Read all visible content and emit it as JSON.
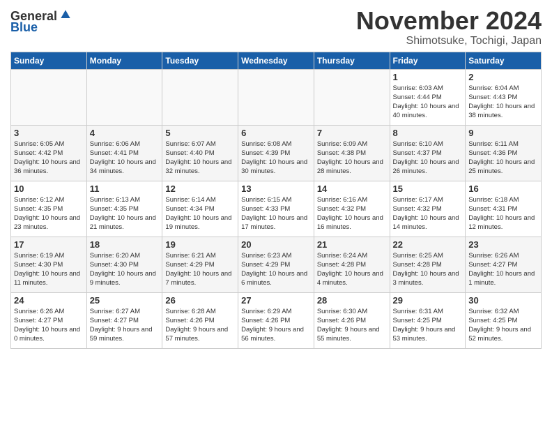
{
  "logo": {
    "general": "General",
    "blue": "Blue"
  },
  "title": "November 2024",
  "location": "Shimotsuke, Tochigi, Japan",
  "headers": [
    "Sunday",
    "Monday",
    "Tuesday",
    "Wednesday",
    "Thursday",
    "Friday",
    "Saturday"
  ],
  "weeks": [
    [
      {
        "day": "",
        "info": ""
      },
      {
        "day": "",
        "info": ""
      },
      {
        "day": "",
        "info": ""
      },
      {
        "day": "",
        "info": ""
      },
      {
        "day": "",
        "info": ""
      },
      {
        "day": "1",
        "info": "Sunrise: 6:03 AM\nSunset: 4:44 PM\nDaylight: 10 hours and 40 minutes."
      },
      {
        "day": "2",
        "info": "Sunrise: 6:04 AM\nSunset: 4:43 PM\nDaylight: 10 hours and 38 minutes."
      }
    ],
    [
      {
        "day": "3",
        "info": "Sunrise: 6:05 AM\nSunset: 4:42 PM\nDaylight: 10 hours and 36 minutes."
      },
      {
        "day": "4",
        "info": "Sunrise: 6:06 AM\nSunset: 4:41 PM\nDaylight: 10 hours and 34 minutes."
      },
      {
        "day": "5",
        "info": "Sunrise: 6:07 AM\nSunset: 4:40 PM\nDaylight: 10 hours and 32 minutes."
      },
      {
        "day": "6",
        "info": "Sunrise: 6:08 AM\nSunset: 4:39 PM\nDaylight: 10 hours and 30 minutes."
      },
      {
        "day": "7",
        "info": "Sunrise: 6:09 AM\nSunset: 4:38 PM\nDaylight: 10 hours and 28 minutes."
      },
      {
        "day": "8",
        "info": "Sunrise: 6:10 AM\nSunset: 4:37 PM\nDaylight: 10 hours and 26 minutes."
      },
      {
        "day": "9",
        "info": "Sunrise: 6:11 AM\nSunset: 4:36 PM\nDaylight: 10 hours and 25 minutes."
      }
    ],
    [
      {
        "day": "10",
        "info": "Sunrise: 6:12 AM\nSunset: 4:35 PM\nDaylight: 10 hours and 23 minutes."
      },
      {
        "day": "11",
        "info": "Sunrise: 6:13 AM\nSunset: 4:35 PM\nDaylight: 10 hours and 21 minutes."
      },
      {
        "day": "12",
        "info": "Sunrise: 6:14 AM\nSunset: 4:34 PM\nDaylight: 10 hours and 19 minutes."
      },
      {
        "day": "13",
        "info": "Sunrise: 6:15 AM\nSunset: 4:33 PM\nDaylight: 10 hours and 17 minutes."
      },
      {
        "day": "14",
        "info": "Sunrise: 6:16 AM\nSunset: 4:32 PM\nDaylight: 10 hours and 16 minutes."
      },
      {
        "day": "15",
        "info": "Sunrise: 6:17 AM\nSunset: 4:32 PM\nDaylight: 10 hours and 14 minutes."
      },
      {
        "day": "16",
        "info": "Sunrise: 6:18 AM\nSunset: 4:31 PM\nDaylight: 10 hours and 12 minutes."
      }
    ],
    [
      {
        "day": "17",
        "info": "Sunrise: 6:19 AM\nSunset: 4:30 PM\nDaylight: 10 hours and 11 minutes."
      },
      {
        "day": "18",
        "info": "Sunrise: 6:20 AM\nSunset: 4:30 PM\nDaylight: 10 hours and 9 minutes."
      },
      {
        "day": "19",
        "info": "Sunrise: 6:21 AM\nSunset: 4:29 PM\nDaylight: 10 hours and 7 minutes."
      },
      {
        "day": "20",
        "info": "Sunrise: 6:23 AM\nSunset: 4:29 PM\nDaylight: 10 hours and 6 minutes."
      },
      {
        "day": "21",
        "info": "Sunrise: 6:24 AM\nSunset: 4:28 PM\nDaylight: 10 hours and 4 minutes."
      },
      {
        "day": "22",
        "info": "Sunrise: 6:25 AM\nSunset: 4:28 PM\nDaylight: 10 hours and 3 minutes."
      },
      {
        "day": "23",
        "info": "Sunrise: 6:26 AM\nSunset: 4:27 PM\nDaylight: 10 hours and 1 minute."
      }
    ],
    [
      {
        "day": "24",
        "info": "Sunrise: 6:26 AM\nSunset: 4:27 PM\nDaylight: 10 hours and 0 minutes."
      },
      {
        "day": "25",
        "info": "Sunrise: 6:27 AM\nSunset: 4:27 PM\nDaylight: 9 hours and 59 minutes."
      },
      {
        "day": "26",
        "info": "Sunrise: 6:28 AM\nSunset: 4:26 PM\nDaylight: 9 hours and 57 minutes."
      },
      {
        "day": "27",
        "info": "Sunrise: 6:29 AM\nSunset: 4:26 PM\nDaylight: 9 hours and 56 minutes."
      },
      {
        "day": "28",
        "info": "Sunrise: 6:30 AM\nSunset: 4:26 PM\nDaylight: 9 hours and 55 minutes."
      },
      {
        "day": "29",
        "info": "Sunrise: 6:31 AM\nSunset: 4:25 PM\nDaylight: 9 hours and 53 minutes."
      },
      {
        "day": "30",
        "info": "Sunrise: 6:32 AM\nSunset: 4:25 PM\nDaylight: 9 hours and 52 minutes."
      }
    ]
  ]
}
